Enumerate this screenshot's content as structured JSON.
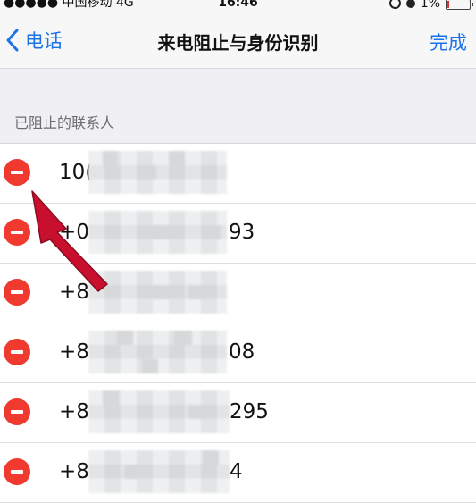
{
  "status_bar": {
    "carrier": "●●●●● 中国移动  4G",
    "time": "16:46",
    "battery": "1%"
  },
  "nav": {
    "back_label": "电话",
    "title": "来电阻止与身份识别",
    "done_label": "完成"
  },
  "section": {
    "header": "已阻止的联系人"
  },
  "blocked_contacts": [
    {
      "prefix": "10(",
      "suffix": ""
    },
    {
      "prefix": "+0(",
      "suffix": "93"
    },
    {
      "prefix": "+8",
      "suffix": ""
    },
    {
      "prefix": "+8",
      "suffix": "08"
    },
    {
      "prefix": "+8",
      "suffix": "295"
    },
    {
      "prefix": "+8",
      "suffix": "4"
    }
  ],
  "colors": {
    "accent": "#1a73e8",
    "delete": "#f03a30",
    "arrow": "#c8102e"
  }
}
